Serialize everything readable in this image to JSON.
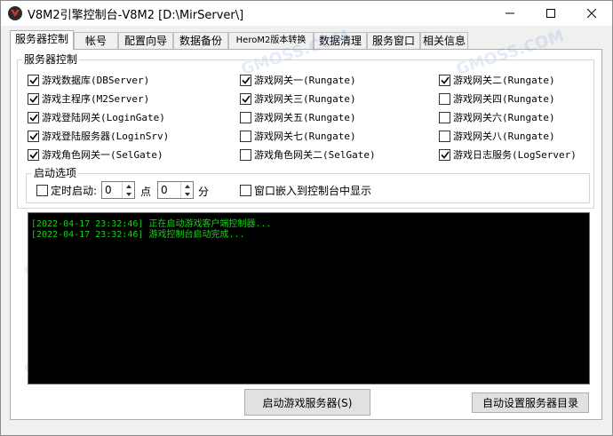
{
  "window": {
    "title": "V8M2引擎控制台-V8M2 [D:\\MirServer\\]"
  },
  "tabs": [
    "服务器控制",
    "帐号",
    "配置向导",
    "数据备份",
    "HeroM2版本转换",
    "数据清理",
    "服务窗口",
    "相关信息"
  ],
  "server_group": {
    "title": "服务器控制",
    "col1": [
      {
        "label": "游戏数据库(DBServer)",
        "checked": true
      },
      {
        "label": "游戏主程序(M2Server)",
        "checked": true
      },
      {
        "label": "游戏登陆网关(LoginGate)",
        "checked": true
      },
      {
        "label": "游戏登陆服务器(LoginSrv)",
        "checked": true
      },
      {
        "label": "游戏角色网关一(SelGate)",
        "checked": true
      }
    ],
    "col2": [
      {
        "label": "游戏网关一(Rungate)",
        "checked": true
      },
      {
        "label": "游戏网关三(Rungate)",
        "checked": true
      },
      {
        "label": "游戏网关五(Rungate)",
        "checked": false
      },
      {
        "label": "游戏网关七(Rungate)",
        "checked": false
      },
      {
        "label": "游戏角色网关二(SelGate)",
        "checked": false
      }
    ],
    "col3": [
      {
        "label": "游戏网关二(Rungate)",
        "checked": true
      },
      {
        "label": "游戏网关四(Rungate)",
        "checked": false
      },
      {
        "label": "游戏网关六(Rungate)",
        "checked": false
      },
      {
        "label": "游戏网关八(Rungate)",
        "checked": false
      },
      {
        "label": "游戏日志服务(LogServer)",
        "checked": true
      }
    ]
  },
  "startup": {
    "title": "启动选项",
    "timed_label": "定时启动:",
    "timed_checked": false,
    "hour": "0",
    "hour_unit": "点",
    "minute": "0",
    "minute_unit": "分",
    "embed_label": "窗口嵌入到控制台中显示",
    "embed_checked": false
  },
  "log": [
    "[2022-04-17 23:32:46] 正在启动游戏客户端控制器...",
    "[2022-04-17 23:32:46] 游戏控制台启动完成..."
  ],
  "buttons": {
    "start": "启动游戏服务器(S)",
    "auto_dir": "自动设置服务器目录"
  },
  "watermark": "GMOSS.COM"
}
